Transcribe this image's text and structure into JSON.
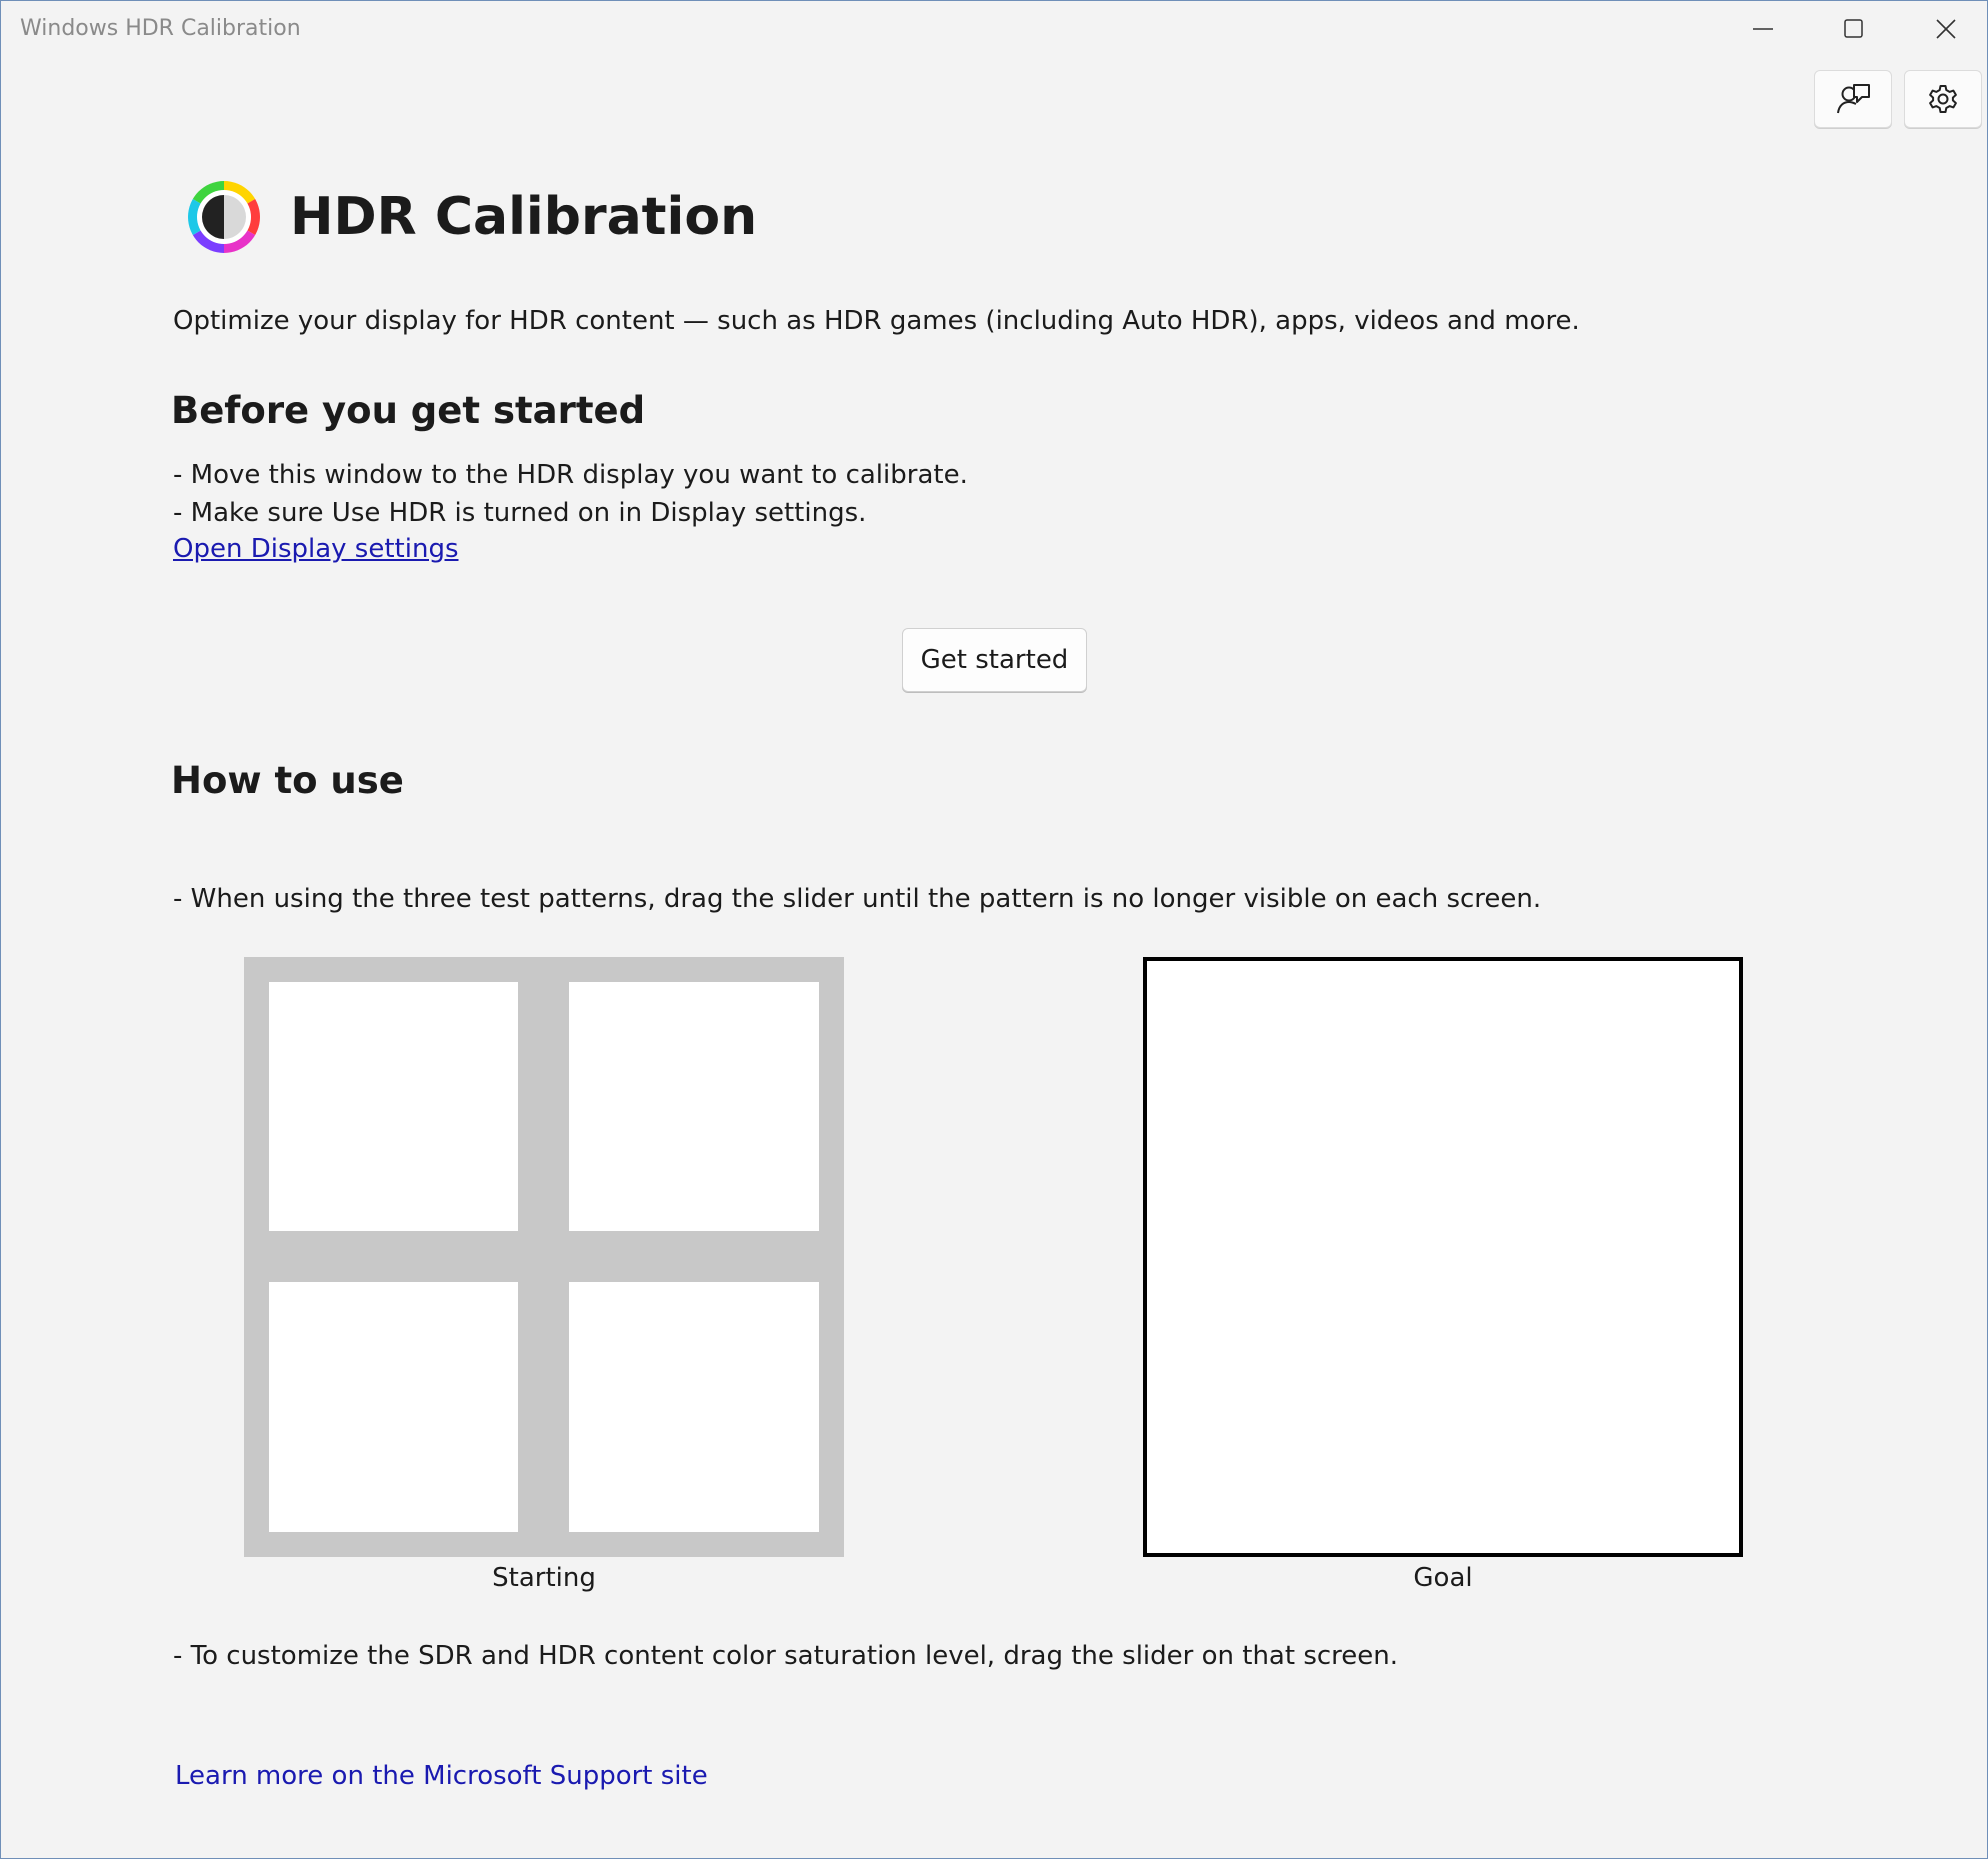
{
  "window": {
    "title": "Windows HDR Calibration",
    "controls": {
      "minimize": "minimize-icon",
      "maximize": "maximize-icon",
      "close": "close-icon"
    }
  },
  "toolbar": {
    "feedback_icon": "feedback-icon",
    "settings_icon": "gear-icon"
  },
  "header": {
    "title": "HDR Calibration",
    "icon": "color-wheel-icon"
  },
  "intro": "Optimize your display for HDR content — such as HDR games (including Auto HDR), apps, videos and more.",
  "before": {
    "heading": "Before you get started",
    "items": [
      "- Move this window to the HDR display you want to calibrate.",
      "- Make sure Use HDR is turned on in Display settings."
    ],
    "link": "Open Display settings"
  },
  "get_started_label": "Get started",
  "how": {
    "heading": "How to use",
    "item1": "- When using the three test patterns, drag the slider until the pattern is no longer visible on each screen.",
    "starting_label": "Starting",
    "goal_label": "Goal",
    "item2": "- To customize the SDR and HDR content color saturation level, drag the slider on that screen."
  },
  "support_link": "Learn more on the Microsoft Support site",
  "colors": {
    "link": "#1a1ab0",
    "background": "#f3f3f3",
    "pattern_gray": "#c8c8c8"
  }
}
